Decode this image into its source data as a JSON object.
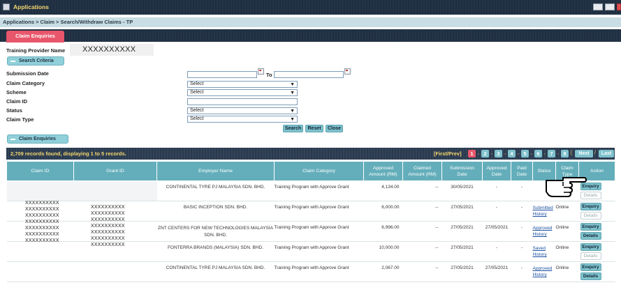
{
  "window": {
    "title": "Applications"
  },
  "breadcrumb": "Applications  > Claim  > Search/Withdraw Claims - TP",
  "tab": {
    "label": "Claim Enquiries"
  },
  "training_provider": {
    "label": "Training Provider Name",
    "value": "XXXXXXXXXX"
  },
  "search_criteria": {
    "toggle_label": "Search Criteria",
    "fields": {
      "submission_date": {
        "label": "Submission Date",
        "to_label": "To",
        "from_value": "",
        "to_value": ""
      },
      "claim_category": {
        "label": "Claim Category",
        "value": "Select"
      },
      "scheme": {
        "label": "Scheme",
        "value": "Select"
      },
      "claim_id": {
        "label": "Claim ID",
        "value": ""
      },
      "status": {
        "label": "Status",
        "value": "Select"
      },
      "claim_type": {
        "label": "Claim Type",
        "value": "Select"
      }
    },
    "buttons": {
      "search": "Search",
      "reset": "Reset",
      "close": "Close"
    }
  },
  "claim_enquiries": {
    "toggle_label": "Claim Enquiries",
    "result_summary": "2,709 records found, displaying 1 to 5 records.",
    "pager": {
      "first_prev": "[First/Prev]",
      "pages": [
        "1",
        "2",
        "3",
        "4",
        "5",
        "6",
        "7",
        "8"
      ],
      "current_page": "1",
      "next": "Next",
      "last": "Last"
    },
    "columns": {
      "claim_id": "Claim ID",
      "grant_id": "Grant ID",
      "employer": "Employer Name",
      "category": "Claim Category",
      "approved_1": "Approved",
      "approved_2": "Amount (RM)",
      "claimed_1": "Claimed",
      "claimed_2": "Amount (RM)",
      "submission_1": "Submission",
      "submission_2": "Date",
      "approved_date_1": "Approved",
      "approved_date_2": "Date",
      "paid_1": "Paid",
      "paid_2": "Date",
      "status": "Status",
      "claim_type_1": "Claim",
      "claim_type_2": "Type",
      "action": "Action"
    },
    "masked_claim_ids": [
      "XXXXXXXXXX",
      "XXXXXXXXXX",
      "XXXXXXXXXX",
      "XXXXXXXXXX",
      "XXXXXXXXXX",
      "XXXXXXXXXX",
      "XXXXXXXXXX"
    ],
    "masked_grant_ids": [
      "XXXXXXXXXX",
      "XXXXXXXXXX",
      "XXXXXXXXXX",
      "XXXXXXXXXX",
      "XXXXXXXXXX",
      "XXXXXXXXXX",
      "XXXXXXXXXX"
    ],
    "rows": [
      {
        "employer": "CONTINENTAL TYRE PJ MALAYSIA SDN. BHD.",
        "category": "Training Program with Approve Grant",
        "approved_amount": "4,134.00",
        "claimed_amount": "--",
        "submission_date": "30/05/2021",
        "approved_date": "-",
        "paid_date": "-",
        "status": "",
        "status2": "",
        "claim_type": "",
        "enquiry": "Enquiry",
        "details": "Details"
      },
      {
        "employer": "BASIC INCEPTION SDN. BHD.",
        "category": "Training Program with Approve Grant",
        "approved_amount": "6,000.00",
        "claimed_amount": "--",
        "submission_date": "27/05/2021",
        "approved_date": "-",
        "paid_date": "-",
        "status": "Submitted",
        "status2": "History",
        "claim_type": "Online",
        "enquiry": "Enquiry",
        "details": "Details"
      },
      {
        "employer": "ZNT CENTERS FOR NEW TECHNOLOGIES MALAYSIA SDN. BHD.",
        "category": "Training Program with Approve Grant",
        "approved_amount": "6,996.00",
        "claimed_amount": "--",
        "submission_date": "27/05/2021",
        "approved_date": "27/05/2021",
        "paid_date": "-",
        "status": "Approved",
        "status2": "History",
        "claim_type": "Online",
        "enquiry": "Enquiry",
        "details": "Details"
      },
      {
        "employer": "FONTERRA BRANDS (MALAYSIA) SDN. BHD.",
        "category": "Training Program with Approve Grant",
        "approved_amount": "10,000.00",
        "claimed_amount": "--",
        "submission_date": "27/05/2021",
        "approved_date": "-",
        "paid_date": "-",
        "status": "Saved",
        "status2": "History",
        "claim_type": "Online",
        "enquiry": "Enquiry",
        "details": "Details"
      },
      {
        "employer": "CONTINENTAL TYRE PJ MALAYSIA SDN. BHD.",
        "category": "Training Program with Approve Grant",
        "approved_amount": "2,067.00",
        "claimed_amount": "--",
        "submission_date": "27/05/2021",
        "approved_date": "27/05/2021",
        "paid_date": "-",
        "status": "Approved",
        "status2": "History",
        "claim_type": "Online",
        "enquiry": "Enquiry",
        "details": "Details"
      }
    ]
  }
}
